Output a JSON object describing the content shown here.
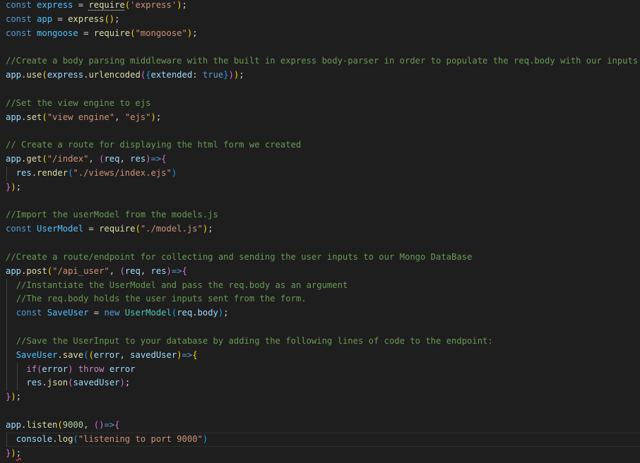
{
  "colors": {
    "background": "#1e1e1e",
    "keyword": "#569cd6",
    "control": "#c586c0",
    "variable": "#9cdcfe",
    "constant": "#4fc1ff",
    "function": "#dcdcaa",
    "string": "#ce9178",
    "number": "#b5cea8",
    "comment": "#6a9955",
    "class": "#4ec9b0",
    "bracket1": "#ffd700",
    "bracket2": "#da70d6",
    "bracket3": "#179fff"
  },
  "code": {
    "lines": [
      {
        "indent": 0,
        "tokens": [
          [
            "kw",
            "const"
          ],
          [
            "plain",
            " "
          ],
          [
            "const",
            "express"
          ],
          [
            "plain",
            " = "
          ],
          [
            "fn",
            "require",
            "squiggle"
          ],
          [
            "brk1",
            "("
          ],
          [
            "str",
            "'express'"
          ],
          [
            "brk1",
            ")"
          ],
          [
            "plain",
            ";"
          ]
        ]
      },
      {
        "indent": 0,
        "tokens": [
          [
            "kw",
            "const"
          ],
          [
            "plain",
            " "
          ],
          [
            "const",
            "app"
          ],
          [
            "plain",
            " = "
          ],
          [
            "fn",
            "express"
          ],
          [
            "brk1",
            "("
          ],
          [
            "brk1",
            ")"
          ],
          [
            "plain",
            ";"
          ]
        ]
      },
      {
        "indent": 0,
        "tokens": [
          [
            "kw",
            "const"
          ],
          [
            "plain",
            " "
          ],
          [
            "const",
            "mongoose"
          ],
          [
            "plain",
            " = "
          ],
          [
            "fn",
            "require"
          ],
          [
            "brk1",
            "("
          ],
          [
            "str",
            "\"mongoose\""
          ],
          [
            "brk1",
            ")"
          ],
          [
            "plain",
            ";"
          ]
        ]
      },
      {
        "indent": 0,
        "tokens": []
      },
      {
        "indent": 0,
        "tokens": [
          [
            "com",
            "//Create a body parsing middleware with the built in express body-parser in order to populate the req.body with our inputs"
          ]
        ]
      },
      {
        "indent": 0,
        "tokens": [
          [
            "var",
            "app"
          ],
          [
            "plain",
            "."
          ],
          [
            "fn",
            "use"
          ],
          [
            "brk1",
            "("
          ],
          [
            "var",
            "express"
          ],
          [
            "plain",
            "."
          ],
          [
            "fn",
            "urlencoded"
          ],
          [
            "brk2",
            "("
          ],
          [
            "brk3",
            "{"
          ],
          [
            "prop",
            "extended"
          ],
          [
            "plain",
            ": "
          ],
          [
            "kwc",
            "true"
          ],
          [
            "brk3",
            "}"
          ],
          [
            "brk2",
            ")"
          ],
          [
            "brk1",
            ")"
          ],
          [
            "plain",
            ";"
          ]
        ]
      },
      {
        "indent": 0,
        "tokens": []
      },
      {
        "indent": 0,
        "tokens": [
          [
            "com",
            "//Set the view engine to ejs"
          ]
        ]
      },
      {
        "indent": 0,
        "tokens": [
          [
            "var",
            "app"
          ],
          [
            "plain",
            "."
          ],
          [
            "fn",
            "set"
          ],
          [
            "brk1",
            "("
          ],
          [
            "str",
            "\"view engine\""
          ],
          [
            "plain",
            ", "
          ],
          [
            "str",
            "\"ejs\""
          ],
          [
            "brk1",
            ")"
          ],
          [
            "plain",
            ";"
          ]
        ]
      },
      {
        "indent": 0,
        "tokens": []
      },
      {
        "indent": 0,
        "tokens": [
          [
            "com",
            "// Create a route for displaying the html form we created"
          ]
        ]
      },
      {
        "indent": 0,
        "tokens": [
          [
            "var",
            "app"
          ],
          [
            "plain",
            "."
          ],
          [
            "fn",
            "get"
          ],
          [
            "brk1",
            "("
          ],
          [
            "str",
            "\"/index\""
          ],
          [
            "plain",
            ", "
          ],
          [
            "brk2",
            "("
          ],
          [
            "var",
            "req"
          ],
          [
            "plain",
            ", "
          ],
          [
            "var",
            "res"
          ],
          [
            "brk2",
            ")"
          ],
          [
            "kw",
            "=>"
          ],
          [
            "brk2",
            "{"
          ]
        ]
      },
      {
        "indent": 1,
        "tokens": [
          [
            "var",
            "res"
          ],
          [
            "plain",
            "."
          ],
          [
            "fn",
            "render"
          ],
          [
            "brk3",
            "("
          ],
          [
            "str",
            "\"./views/index.ejs\""
          ],
          [
            "brk3",
            ")"
          ]
        ]
      },
      {
        "indent": 0,
        "tokens": [
          [
            "brk2",
            "}"
          ],
          [
            "brk1",
            ")"
          ],
          [
            "plain",
            ";"
          ]
        ]
      },
      {
        "indent": 0,
        "tokens": []
      },
      {
        "indent": 0,
        "tokens": [
          [
            "com",
            "//Import the userModel from the models.js"
          ]
        ]
      },
      {
        "indent": 0,
        "tokens": [
          [
            "kw",
            "const"
          ],
          [
            "plain",
            " "
          ],
          [
            "const",
            "UserModel"
          ],
          [
            "plain",
            " = "
          ],
          [
            "fn",
            "require"
          ],
          [
            "brk1",
            "("
          ],
          [
            "str",
            "\"./model.js\""
          ],
          [
            "brk1",
            ")"
          ],
          [
            "plain",
            ";"
          ]
        ]
      },
      {
        "indent": 0,
        "tokens": []
      },
      {
        "indent": 0,
        "tokens": [
          [
            "com",
            "//Create a route/endpoint for collecting and sending the user inputs to our Mongo DataBase"
          ]
        ]
      },
      {
        "indent": 0,
        "tokens": [
          [
            "var",
            "app"
          ],
          [
            "plain",
            "."
          ],
          [
            "fn",
            "post"
          ],
          [
            "brk1",
            "("
          ],
          [
            "str",
            "\"/api_user\""
          ],
          [
            "plain",
            ", "
          ],
          [
            "brk2",
            "("
          ],
          [
            "var",
            "req"
          ],
          [
            "plain",
            ", "
          ],
          [
            "var",
            "res"
          ],
          [
            "brk2",
            ")"
          ],
          [
            "kw",
            "=>"
          ],
          [
            "brk2",
            "{"
          ]
        ]
      },
      {
        "indent": 1,
        "tokens": [
          [
            "com",
            "//Instantiate the UserModel and pass the req.body as an argument"
          ]
        ]
      },
      {
        "indent": 1,
        "tokens": [
          [
            "com",
            "//The req.body holds the user inputs sent from the form."
          ]
        ]
      },
      {
        "indent": 1,
        "tokens": [
          [
            "kw",
            "const"
          ],
          [
            "plain",
            " "
          ],
          [
            "const",
            "SaveUser"
          ],
          [
            "plain",
            " = "
          ],
          [
            "kw",
            "new"
          ],
          [
            "plain",
            " "
          ],
          [
            "cls",
            "UserModel"
          ],
          [
            "brk3",
            "("
          ],
          [
            "var",
            "req"
          ],
          [
            "plain",
            "."
          ],
          [
            "var",
            "body"
          ],
          [
            "brk3",
            ")"
          ],
          [
            "plain",
            ";"
          ]
        ]
      },
      {
        "indent": 1,
        "tokens": []
      },
      {
        "indent": 1,
        "tokens": [
          [
            "com",
            "//Save the UserInput to your database by adding the following lines of code to the endpoint:"
          ]
        ]
      },
      {
        "indent": 1,
        "tokens": [
          [
            "const",
            "SaveUser"
          ],
          [
            "plain",
            "."
          ],
          [
            "fn",
            "save"
          ],
          [
            "brk3",
            "("
          ],
          [
            "brk1",
            "("
          ],
          [
            "var",
            "error"
          ],
          [
            "plain",
            ", "
          ],
          [
            "var",
            "savedUser"
          ],
          [
            "brk1",
            ")"
          ],
          [
            "kw",
            "=>"
          ],
          [
            "brk1",
            "{"
          ]
        ]
      },
      {
        "indent": 2,
        "tokens": [
          [
            "ctrl",
            "if"
          ],
          [
            "brk2",
            "("
          ],
          [
            "var",
            "error"
          ],
          [
            "brk2",
            ")"
          ],
          [
            "plain",
            " "
          ],
          [
            "ctrl",
            "throw"
          ],
          [
            "plain",
            " "
          ],
          [
            "var",
            "error"
          ]
        ]
      },
      {
        "indent": 2,
        "tokens": [
          [
            "var",
            "res"
          ],
          [
            "plain",
            "."
          ],
          [
            "fn",
            "json"
          ],
          [
            "brk2",
            "("
          ],
          [
            "var",
            "savedUser"
          ],
          [
            "brk2",
            ")"
          ],
          [
            "plain",
            ";"
          ]
        ]
      },
      {
        "indent": 0,
        "tokens": [
          [
            "brk2",
            "}"
          ],
          [
            "brk1",
            ")"
          ],
          [
            "plain",
            ";"
          ]
        ]
      },
      {
        "indent": 0,
        "tokens": []
      },
      {
        "indent": 0,
        "tokens": [
          [
            "var",
            "app"
          ],
          [
            "plain",
            "."
          ],
          [
            "fn",
            "listen"
          ],
          [
            "brk1",
            "("
          ],
          [
            "num",
            "9000"
          ],
          [
            "plain",
            ", "
          ],
          [
            "brk2",
            "("
          ],
          [
            "brk2",
            ")"
          ],
          [
            "kw",
            "=>"
          ],
          [
            "brk2",
            "{"
          ]
        ]
      },
      {
        "indent": 1,
        "tokens": [
          [
            "var",
            "console"
          ],
          [
            "plain",
            "."
          ],
          [
            "fn",
            "log"
          ],
          [
            "brk3",
            "("
          ],
          [
            "str",
            "\"listening to port 9000\""
          ],
          [
            "brk3",
            ")"
          ]
        ]
      },
      {
        "indent": 0,
        "tokens": [
          [
            "brk2",
            "}"
          ],
          [
            "brk1",
            ")"
          ],
          [
            "plain",
            ";",
            "squiggle-red"
          ]
        ]
      }
    ]
  }
}
